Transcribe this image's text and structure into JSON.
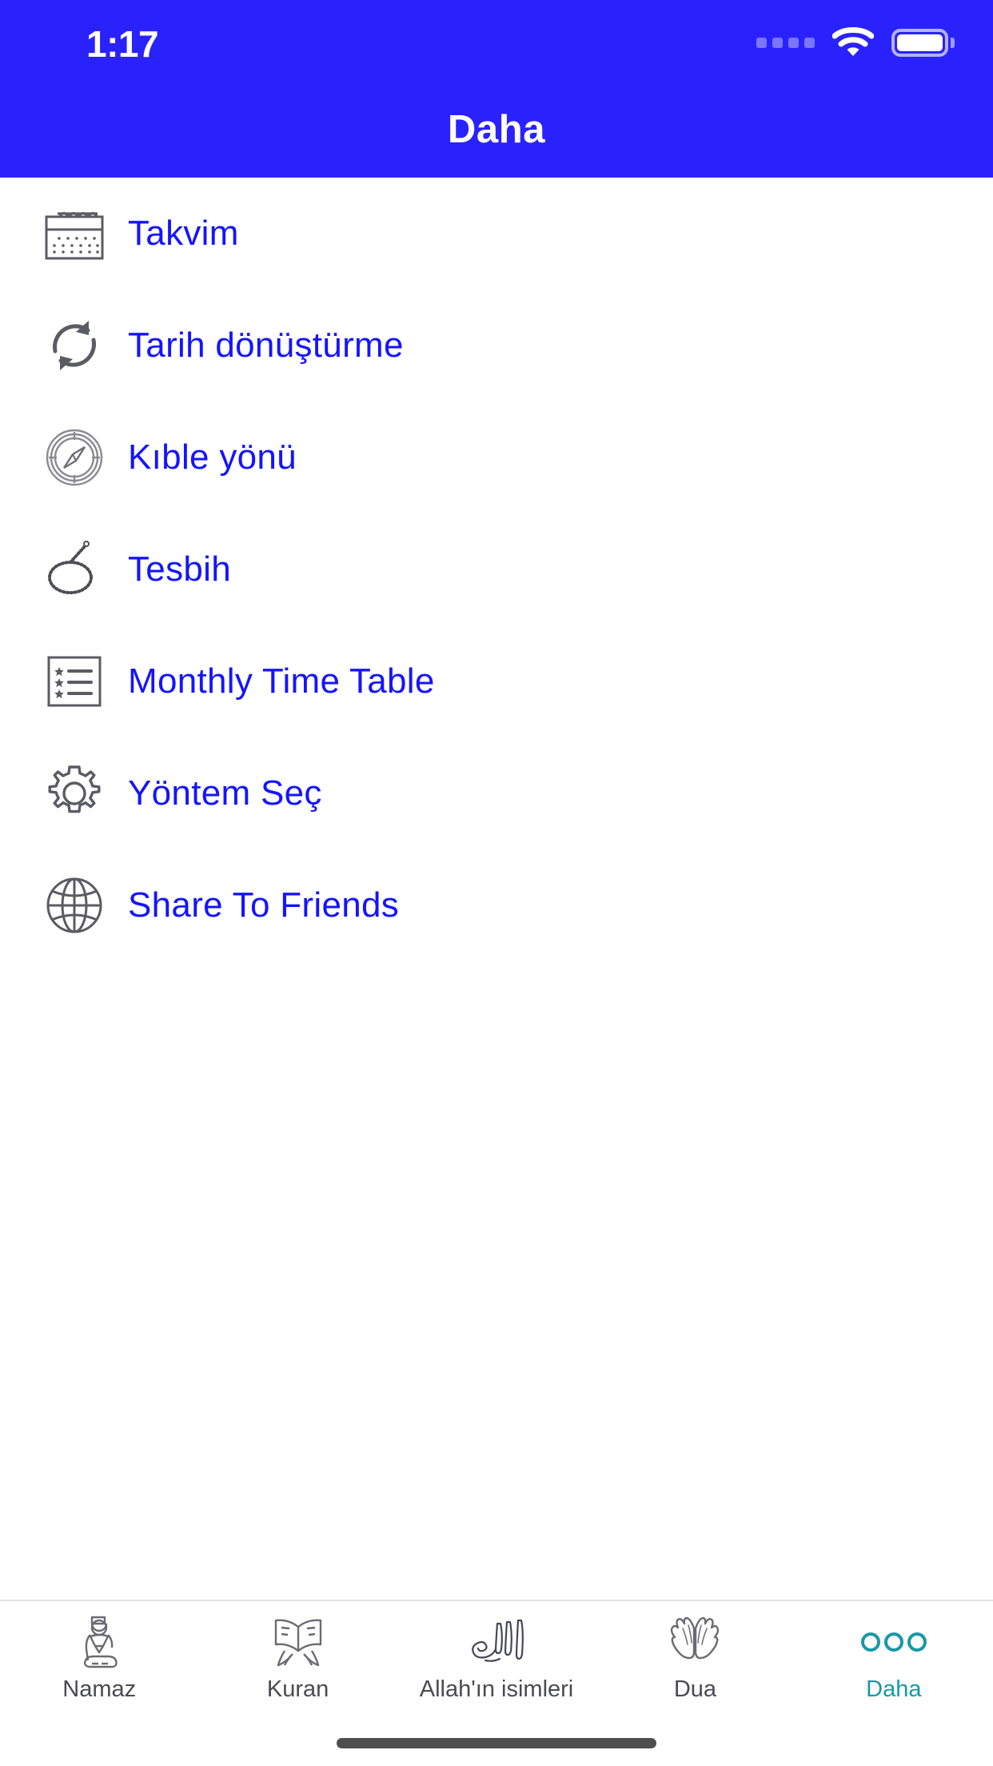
{
  "status_bar": {
    "time": "1:17",
    "signal_icon": "signal-dots-icon",
    "wifi_icon": "wifi-icon",
    "battery_icon": "battery-full-icon"
  },
  "header": {
    "title": "Daha",
    "background_color": "#2a22fd",
    "title_color": "#ffffff"
  },
  "theme": {
    "link_color": "#1414ff",
    "icon_stroke": "#5b5b63",
    "active_tab_color": "#1799a6",
    "inactive_tab_color": "#4a4a52",
    "page_background": "#ffffff"
  },
  "menu": {
    "items": [
      {
        "label": "Takvim",
        "icon": "calendar-icon"
      },
      {
        "label": "Tarih dönüştürme",
        "icon": "refresh-convert-icon"
      },
      {
        "label": "Kıble yönü",
        "icon": "compass-icon"
      },
      {
        "label": "Tesbih",
        "icon": "prayer-beads-icon"
      },
      {
        "label": "Monthly Time Table",
        "icon": "star-list-icon"
      },
      {
        "label": "Yöntem Seç",
        "icon": "gear-icon"
      },
      {
        "label": "Share To Friends",
        "icon": "globe-icon"
      }
    ]
  },
  "tab_bar": {
    "items": [
      {
        "label": "Namaz",
        "icon": "praying-person-icon",
        "active": false
      },
      {
        "label": "Kuran",
        "icon": "open-quran-book-icon",
        "active": false
      },
      {
        "label": "Allah'ın isimleri",
        "icon": "allah-calligraphy-icon",
        "active": false
      },
      {
        "label": "Dua",
        "icon": "praying-hands-icon",
        "active": false
      },
      {
        "label": "Daha",
        "icon": "three-circles-more-icon",
        "active": true
      }
    ]
  },
  "home_indicator": {
    "visible": true
  }
}
